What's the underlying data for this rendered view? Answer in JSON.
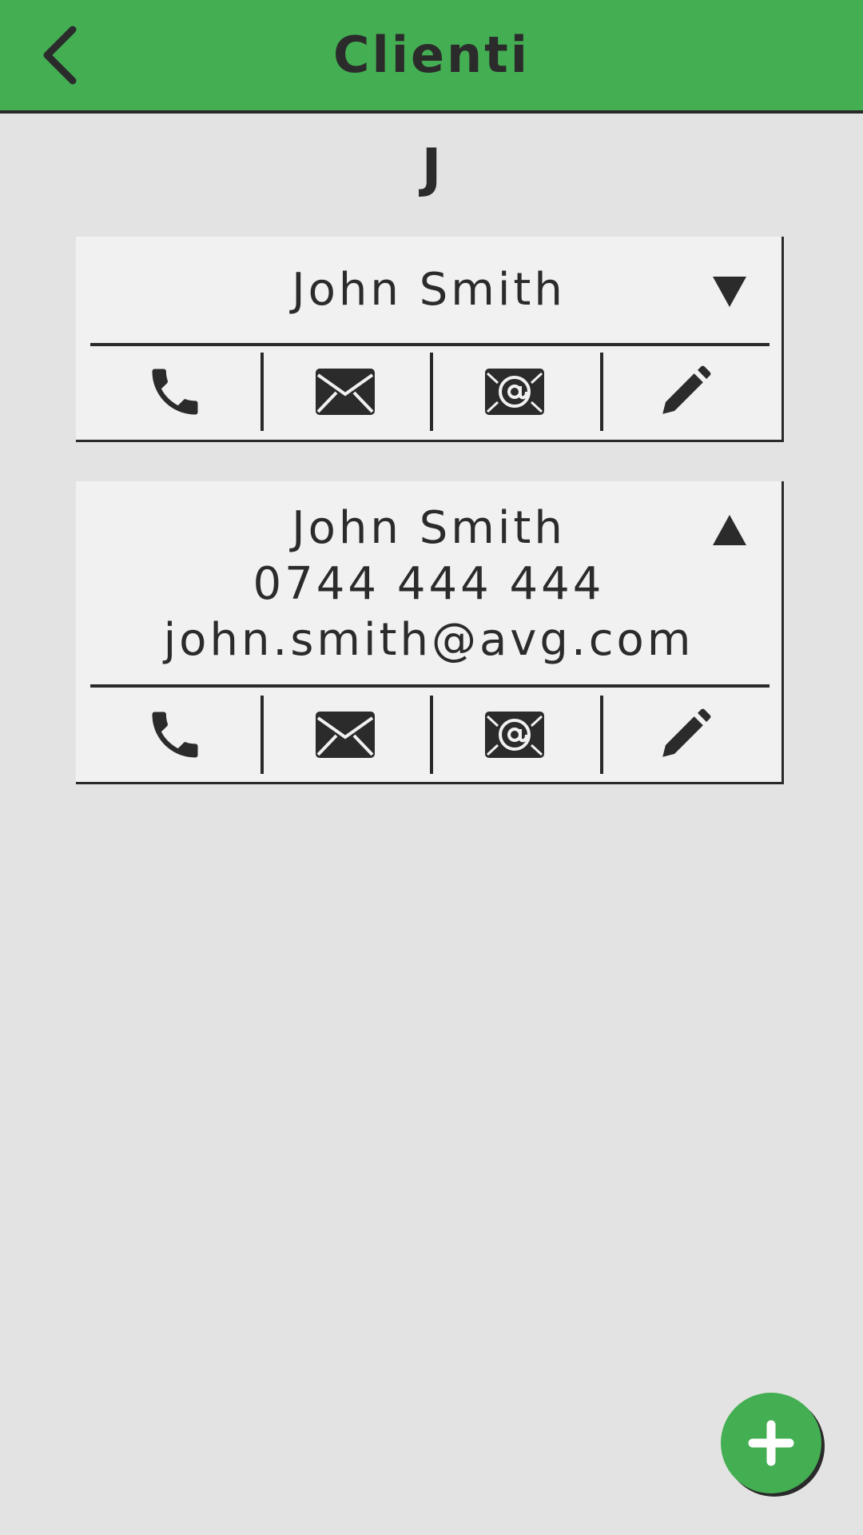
{
  "app_bar": {
    "title": "Clienti",
    "back_icon": "chevron-left-icon",
    "color": "#44ae52"
  },
  "section": {
    "letter": "J"
  },
  "contacts": [
    {
      "name": "John Smith",
      "expanded": false,
      "toggle_icon": "triangle-down-icon",
      "actions": [
        "phone-icon",
        "envelope-icon",
        "email-at-icon",
        "pencil-icon"
      ]
    },
    {
      "name": "John Smith",
      "phone": "0744 444 444",
      "email": "john.smith@avg.com",
      "expanded": true,
      "toggle_icon": "triangle-up-icon",
      "actions": [
        "phone-icon",
        "envelope-icon",
        "email-at-icon",
        "pencil-icon"
      ]
    }
  ],
  "fab": {
    "icon": "plus-icon",
    "color": "#44ae52"
  },
  "colors": {
    "background": "#e3e3e3",
    "card": "#f1f1f1",
    "text": "#2b2b2b"
  }
}
